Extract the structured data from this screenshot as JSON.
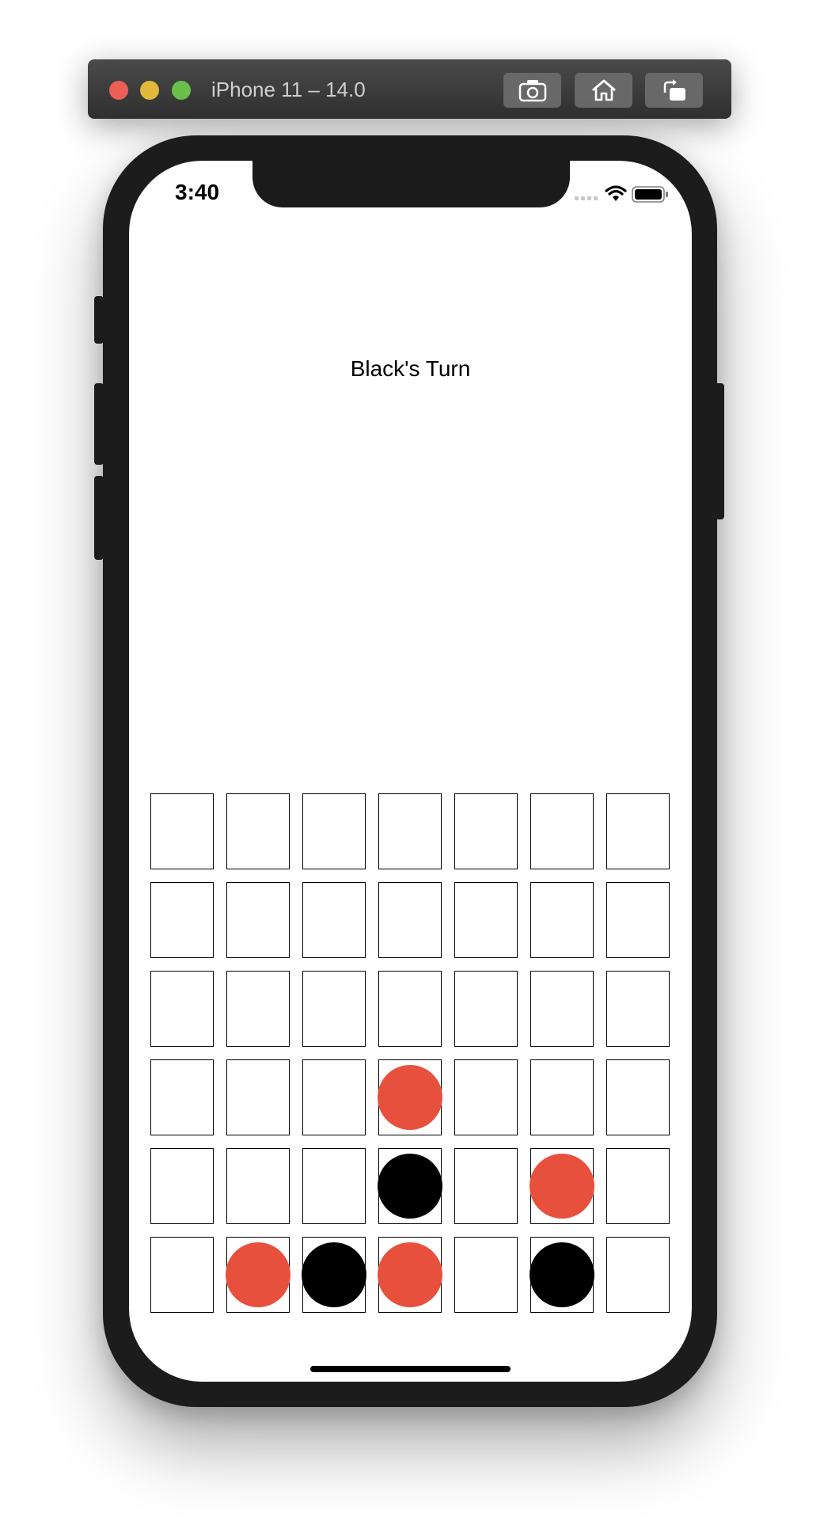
{
  "simulator": {
    "title": "iPhone 11 – 14.0",
    "buttons": [
      "screenshot-icon",
      "home-icon",
      "rotate-icon"
    ]
  },
  "status_bar": {
    "time": "3:40",
    "icons": [
      "cellular-signal-icon",
      "wifi-icon",
      "battery-icon"
    ]
  },
  "game": {
    "turn_label": "Black's Turn",
    "rows": 6,
    "columns": 7,
    "colors": {
      "red": "#e8503e",
      "black": "#000000"
    },
    "board": [
      [
        "",
        "",
        "",
        "",
        "",
        "",
        ""
      ],
      [
        "",
        "",
        "",
        "",
        "",
        "",
        ""
      ],
      [
        "",
        "",
        "",
        "",
        "",
        "",
        ""
      ],
      [
        "",
        "",
        "",
        "red",
        "",
        "",
        ""
      ],
      [
        "",
        "",
        "",
        "black",
        "",
        "red",
        ""
      ],
      [
        "",
        "red",
        "black",
        "red",
        "",
        "black",
        ""
      ]
    ]
  }
}
